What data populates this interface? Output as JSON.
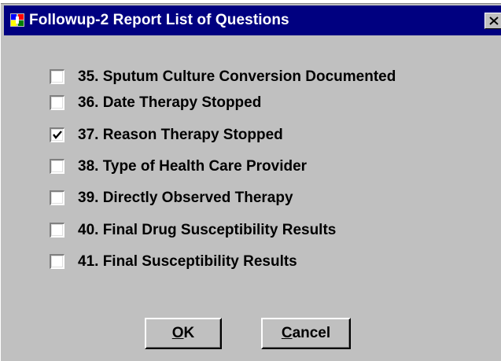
{
  "window": {
    "title": "Followup-2 Report List of Questions",
    "close_label": "×"
  },
  "questions": [
    {
      "label": "35. Sputum Culture Conversion Documented",
      "checked": false
    },
    {
      "label": "36. Date Therapy Stopped",
      "checked": false
    },
    {
      "label": "37. Reason Therapy Stopped",
      "checked": true
    },
    {
      "label": "38. Type of Health Care Provider",
      "checked": false
    },
    {
      "label": "39. Directly Observed Therapy",
      "checked": false
    },
    {
      "label": "40. Final Drug Susceptibility Results",
      "checked": false
    },
    {
      "label": "41. Final Susceptibility Results",
      "checked": false
    }
  ],
  "buttons": {
    "ok_mnemonic": "O",
    "ok_rest": "K",
    "cancel_mnemonic": "C",
    "cancel_rest": "ancel"
  },
  "colors": {
    "titlebar": "#000080",
    "face": "#c0c0c0"
  }
}
